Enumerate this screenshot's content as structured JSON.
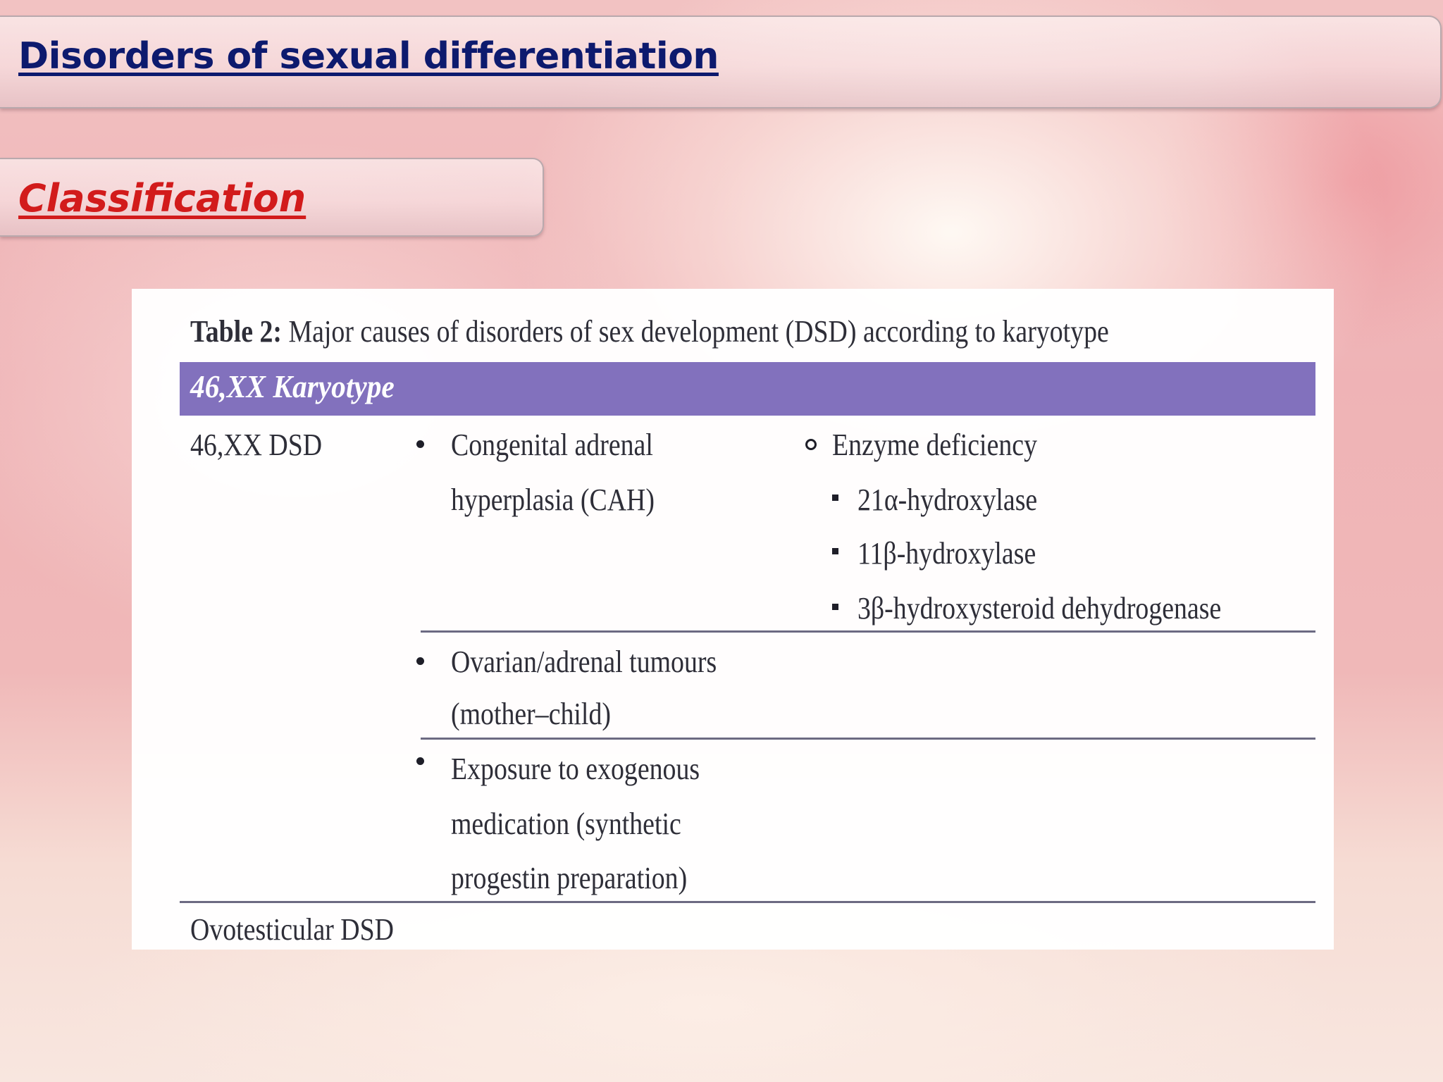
{
  "slide": {
    "title": "Disorders of sexual differentiation",
    "section": "Classification"
  },
  "table": {
    "caption_label": "Table 2:",
    "caption_text": " Major causes of disorders of sex development (DSD) according to karyotype",
    "header": "46,XX Karyotype",
    "row1": {
      "category": "46,XX DSD",
      "cause_line1": "Congenital adrenal",
      "cause_line2": "hyperplasia (CAH)",
      "subcause": "Enzyme deficiency",
      "details": [
        "21α-hydroxylase",
        "11β-hydroxylase",
        "3β-hydroxysteroid dehydrogenase"
      ]
    },
    "row2": {
      "cause_line1": "Ovarian/adrenal tumours",
      "cause_line2": "(mother–child)"
    },
    "row3": {
      "cause_line1": "Exposure to exogenous",
      "cause_line2": "medication (synthetic",
      "cause_line3": "progestin preparation)"
    },
    "row4": {
      "category": "Ovotesticular DSD"
    }
  }
}
